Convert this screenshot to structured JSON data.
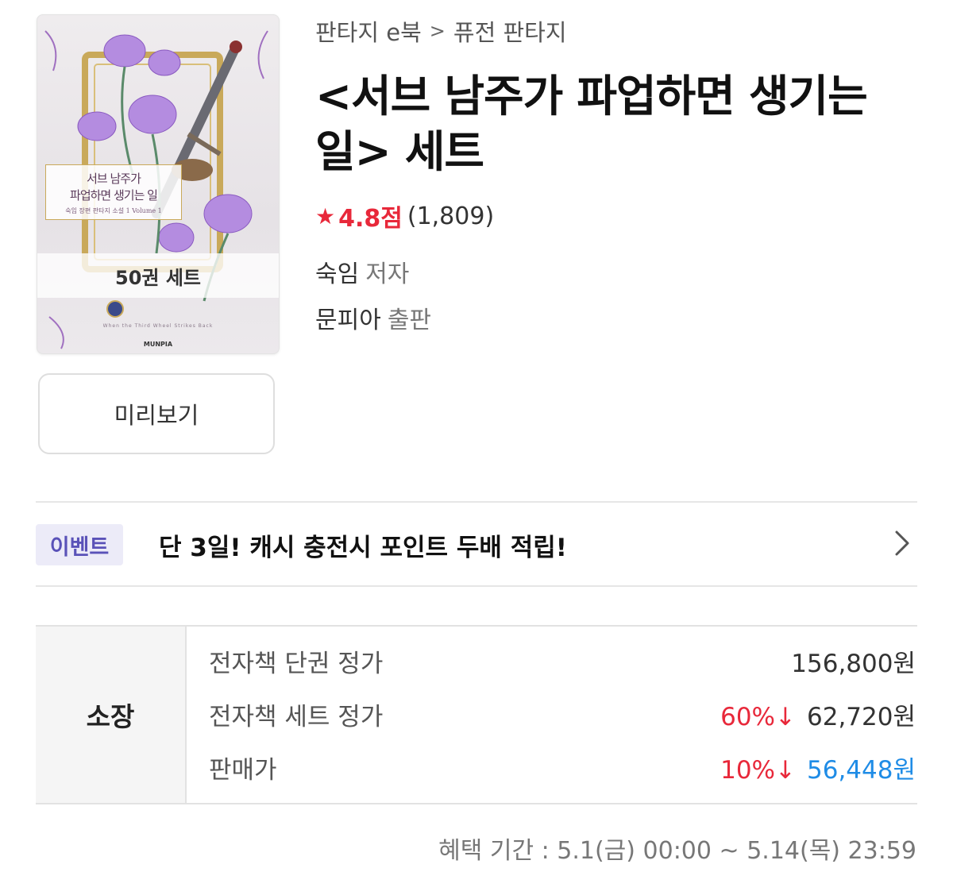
{
  "cover": {
    "title_line1": "서브 남주가",
    "title_line2": "파업하면 생기는 일",
    "title_line3": "숙임 장편 판타지 소설 1 Volume 1",
    "set_label": "50권 세트",
    "subtitle": "When the Third Wheel Strikes Back",
    "publisher_logo": "MUNPIA"
  },
  "preview_label": "미리보기",
  "breadcrumb": {
    "category": "판타지 e북",
    "separator": ">",
    "subcategory": "퓨전 판타지"
  },
  "product": {
    "title_line1": "<서브 남주가 파업하면 생기는",
    "title_line2": "일> 세트",
    "rating_score": "4.8점",
    "rating_count": "(1,809)",
    "author": "숙임",
    "author_role": "저자",
    "publisher": "문피아",
    "publisher_role": "출판"
  },
  "event": {
    "badge": "이벤트",
    "text": "단 3일! 캐시 충전시 포인트 두배 적립!"
  },
  "price": {
    "section_label": "소장",
    "rows": [
      {
        "label": "전자책 단권 정가",
        "discount": "",
        "value": "156,800원"
      },
      {
        "label": "전자책 세트 정가",
        "discount": "60%↓",
        "value": "62,720원"
      },
      {
        "label": "판매가",
        "discount": "10%↓",
        "value": "56,448원"
      }
    ],
    "benefit_period": "혜택 기간 : 5.1(금) 00:00 ~ 5.14(목) 23:59"
  },
  "colors": {
    "accent_red": "#e8283a",
    "sale_blue": "#1f8ce6",
    "event_purple": "#5a52b8"
  }
}
